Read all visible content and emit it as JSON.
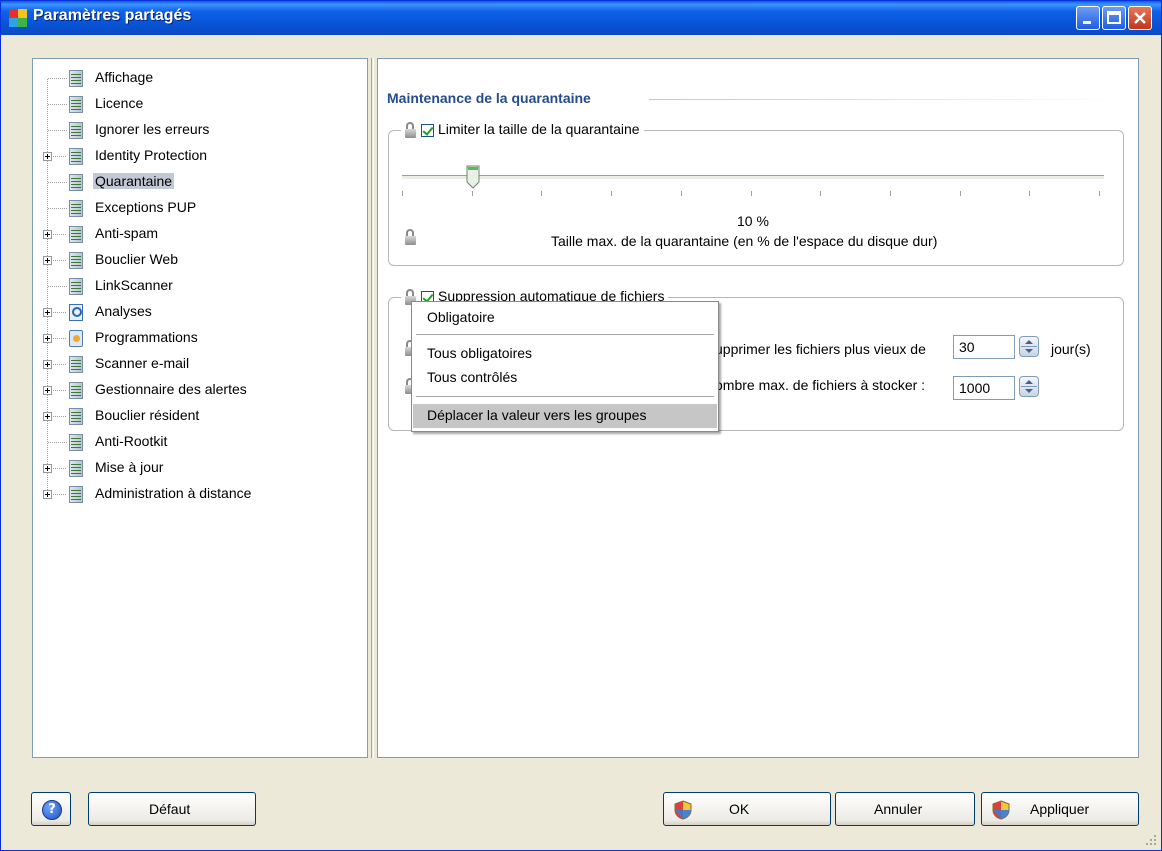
{
  "window": {
    "title": "Paramètres partagés"
  },
  "tree": {
    "items": [
      {
        "label": "Affichage",
        "expandable": false,
        "selected": false
      },
      {
        "label": "Licence",
        "expandable": false,
        "selected": false
      },
      {
        "label": "Ignorer les erreurs",
        "expandable": false,
        "selected": false
      },
      {
        "label": "Identity Protection",
        "expandable": true,
        "selected": false
      },
      {
        "label": "Quarantaine",
        "expandable": false,
        "selected": true
      },
      {
        "label": "Exceptions PUP",
        "expandable": false,
        "selected": false
      },
      {
        "label": "Anti-spam",
        "expandable": true,
        "selected": false
      },
      {
        "label": "Bouclier Web",
        "expandable": true,
        "selected": false
      },
      {
        "label": "LinkScanner",
        "expandable": false,
        "selected": false
      },
      {
        "label": "Analyses",
        "expandable": true,
        "selected": false,
        "icon": "search"
      },
      {
        "label": "Programmations",
        "expandable": true,
        "selected": false,
        "icon": "schedule"
      },
      {
        "label": "Scanner e-mail",
        "expandable": true,
        "selected": false
      },
      {
        "label": "Gestionnaire des alertes",
        "expandable": true,
        "selected": false
      },
      {
        "label": "Bouclier résident",
        "expandable": true,
        "selected": false
      },
      {
        "label": "Anti-Rootkit",
        "expandable": false,
        "selected": false
      },
      {
        "label": "Mise à jour",
        "expandable": true,
        "selected": false
      },
      {
        "label": "Administration à distance",
        "expandable": true,
        "selected": false
      }
    ]
  },
  "main": {
    "section_title": "Maintenance de la quarantaine",
    "group1": {
      "checkbox_label": "Limiter la taille de la quarantaine",
      "checked": true,
      "slider_value_text": "10 %",
      "slider_value": 10,
      "slider_caption": "Taille max. de la quarantaine (en % de l'espace du disque dur)"
    },
    "group2": {
      "checkbox_label": "Suppression automatique de fichiers",
      "checked": true,
      "row1_label": "upprimer les fichiers plus vieux de",
      "row1_value": "30",
      "row1_unit": "jour(s)",
      "row2_label": "ombre max. de fichiers à stocker :",
      "row2_value": "1000"
    }
  },
  "context_menu": {
    "items": [
      {
        "label": "Obligatoire"
      },
      {
        "label": "Tous obligatoires"
      },
      {
        "label": "Tous contrôlés"
      },
      {
        "label": "Déplacer la valeur vers les groupes"
      }
    ]
  },
  "buttons": {
    "default_label": "Défaut",
    "ok_label": "OK",
    "cancel_label": "Annuler",
    "apply_label": "Appliquer"
  },
  "colors": {
    "titlebar": "#0753d6",
    "section_title": "#244c8c",
    "selection": "#c2c8d4",
    "menu_hover": "#c6c6c6"
  }
}
